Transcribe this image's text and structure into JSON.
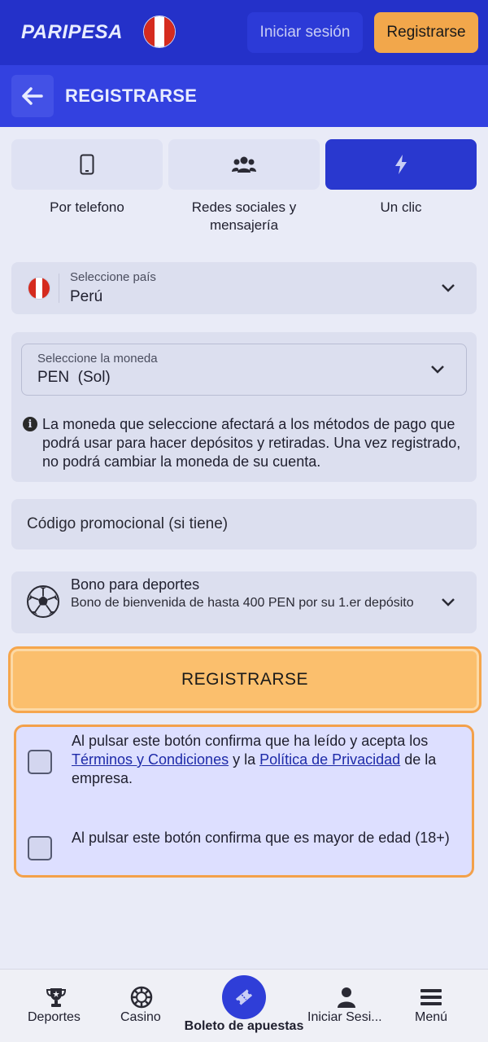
{
  "header": {
    "logo": "PARIPESA",
    "login_label": "Iniciar sesión",
    "register_label": "Registrarse"
  },
  "title_bar": {
    "title": "REGISTRARSE"
  },
  "tabs": [
    {
      "label": "Por telefono",
      "icon": "phone-icon",
      "active": false
    },
    {
      "label": "Redes sociales y mensajería",
      "icon": "users-icon",
      "active": false
    },
    {
      "label": "Un clic",
      "icon": "lightning-icon",
      "active": true
    }
  ],
  "country": {
    "label": "Seleccione país",
    "value": "Perú"
  },
  "currency": {
    "label": "Seleccione la moneda",
    "value": "PEN  (Sol)",
    "info": "La moneda que seleccione afectará a los métodos de pago que podrá usar para hacer depósitos y retiradas. Una vez registrado, no podrá cambiar la moneda de su cuenta."
  },
  "promo": {
    "placeholder": "Código promocional (si tiene)"
  },
  "bonus": {
    "title": "Bono para deportes",
    "description": "Bono de bienvenida de hasta 400 PEN por su 1.er depósito"
  },
  "register_button": "REGISTRARSE",
  "consent": {
    "terms_prefix": "Al pulsar este botón confirma que ha leído y acepta los ",
    "terms_link": "Términos y Condiciones",
    "terms_middle": " y la ",
    "privacy_link": "Política de Privacidad",
    "terms_suffix": " de la empresa.",
    "age_text": "Al pulsar este botón confirma que es mayor de edad (18+)"
  },
  "bottom_nav": {
    "sports": "Deportes",
    "casino": "Casino",
    "betslip": "Boleto de apuestas",
    "login": "Iniciar Sesi...",
    "menu": "Menú"
  },
  "colors": {
    "header_bg": "#2431c9",
    "accent_orange": "#f2a74b",
    "active_tab": "#2938cf",
    "flag_red": "#d52b1e"
  }
}
